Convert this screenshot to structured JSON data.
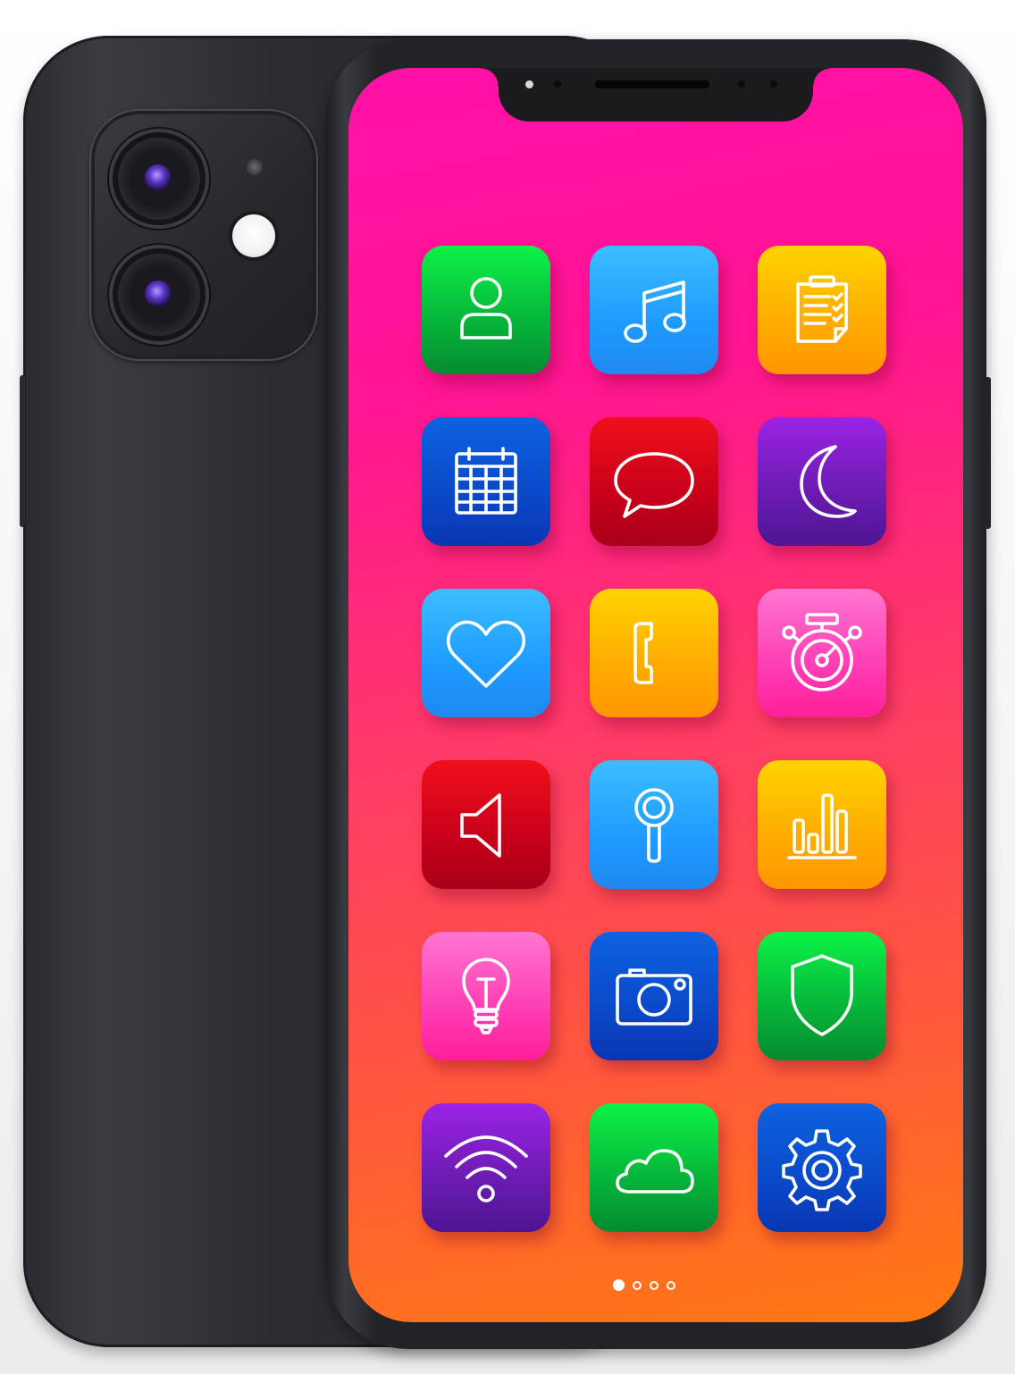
{
  "home_screen": {
    "apps": [
      {
        "icon": "person-icon",
        "color": "#06b33a"
      },
      {
        "icon": "music-note-icon",
        "color": "#1e9bff"
      },
      {
        "icon": "clipboard-checklist-icon",
        "color": "#ffab00"
      },
      {
        "icon": "calendar-icon",
        "color": "#0a49c9"
      },
      {
        "icon": "message-bubble-icon",
        "color": "#c8001a"
      },
      {
        "icon": "moon-icon",
        "color": "#6a1bb0"
      },
      {
        "icon": "heart-icon",
        "color": "#1e9bff"
      },
      {
        "icon": "phone-icon",
        "color": "#ffab00"
      },
      {
        "icon": "stopwatch-icon",
        "color": "#ff3db5"
      },
      {
        "icon": "speaker-icon",
        "color": "#c8001a"
      },
      {
        "icon": "magnifier-icon",
        "color": "#1e9bff"
      },
      {
        "icon": "bar-chart-icon",
        "color": "#ffab00"
      },
      {
        "icon": "lightbulb-icon",
        "color": "#ff3db5"
      },
      {
        "icon": "camera-icon",
        "color": "#0a49c9"
      },
      {
        "icon": "shield-icon",
        "color": "#06b33a"
      },
      {
        "icon": "wifi-icon",
        "color": "#6a1bb0"
      },
      {
        "icon": "cloud-icon",
        "color": "#06b33a"
      },
      {
        "icon": "gear-icon",
        "color": "#0a49c9"
      }
    ],
    "page_indicator": {
      "pages": 4,
      "current": 1
    }
  },
  "colors": {
    "wallpaper_top": "#ff10a8",
    "wallpaper_bottom": "#ff7a12",
    "phone_body": "#2c2d31"
  }
}
